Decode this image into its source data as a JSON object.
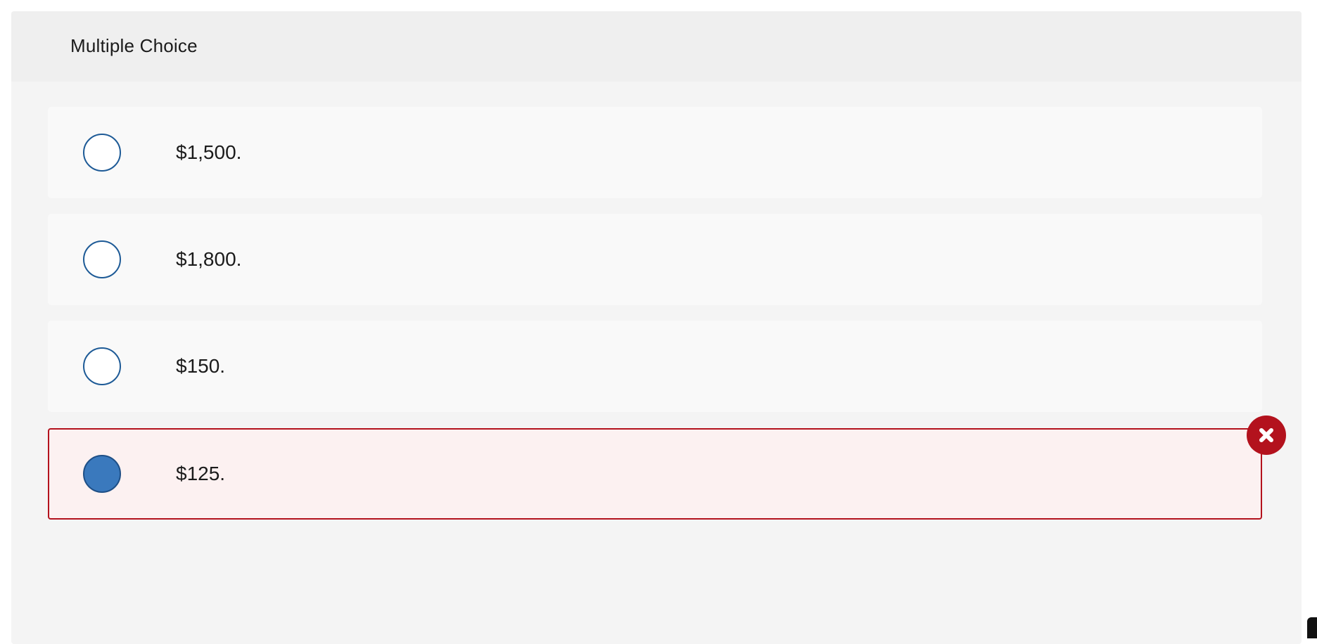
{
  "question": {
    "type_label": "Multiple Choice",
    "choices": [
      {
        "label": "$1,500.",
        "selected": false,
        "state": "neutral"
      },
      {
        "label": "$1,800.",
        "selected": false,
        "state": "neutral"
      },
      {
        "label": "$150.",
        "selected": false,
        "state": "neutral"
      },
      {
        "label": "$125.",
        "selected": true,
        "state": "incorrect"
      }
    ]
  },
  "icons": {
    "incorrect": "close-icon"
  },
  "colors": {
    "radio_border": "#1d5a96",
    "radio_selected_fill": "#3a79bd",
    "incorrect_accent": "#b3121d",
    "incorrect_background": "#fcf1f1",
    "panel_background": "#f4f4f4",
    "choice_background": "#f9f9f9"
  }
}
